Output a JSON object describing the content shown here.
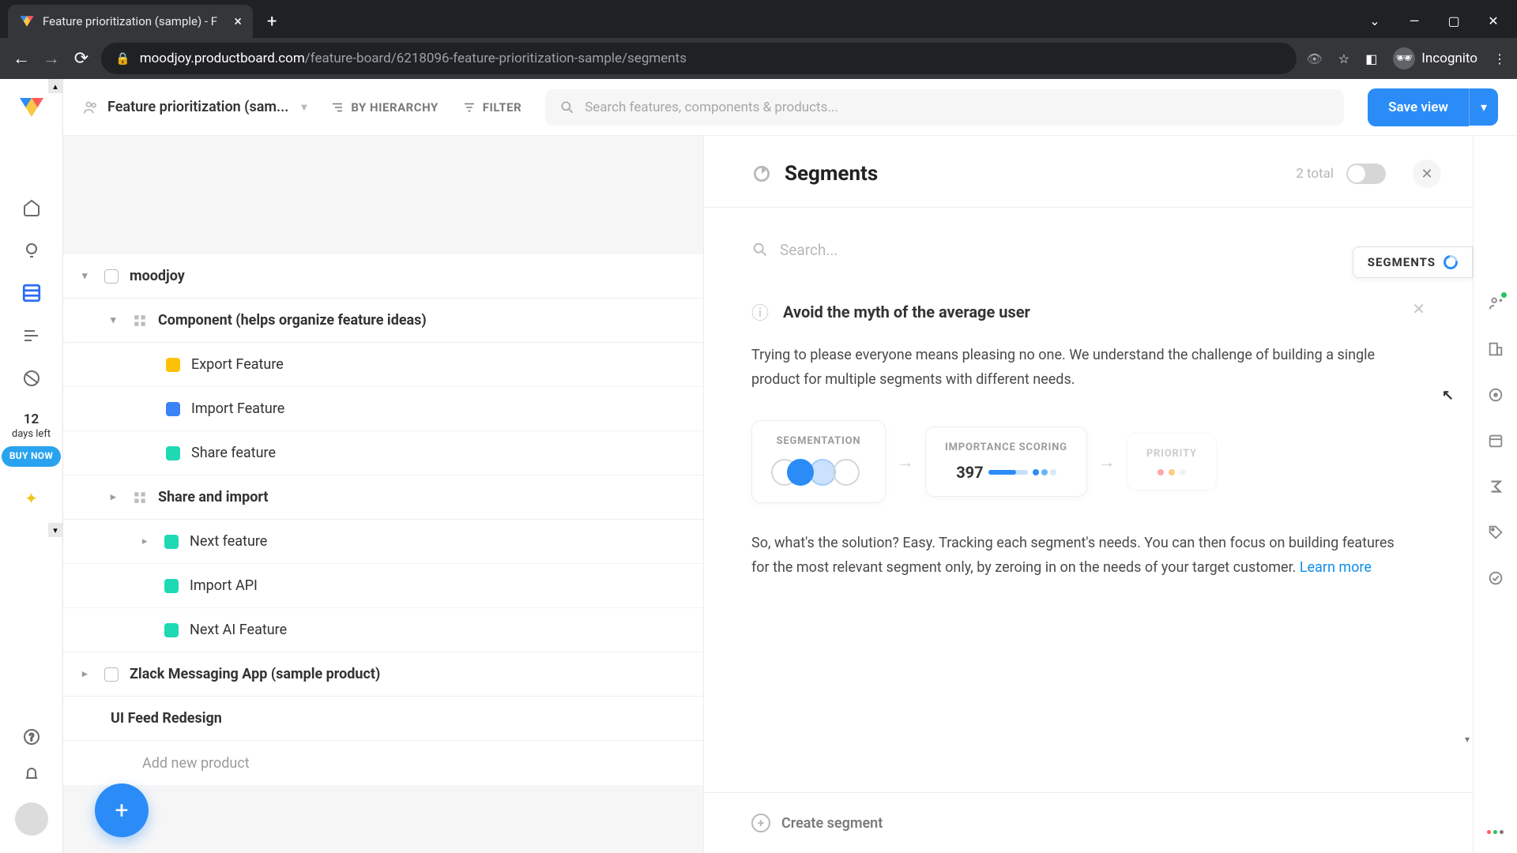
{
  "browser": {
    "tab_title": "Feature prioritization (sample) - F",
    "url_host": "moodjoy.productboard.com",
    "url_path": "/feature-board/6218096-feature-prioritization-sample/segments",
    "incognito_label": "Incognito"
  },
  "rail": {
    "trial_num": "12",
    "trial_label": "days left",
    "buy_now": "BUY NOW"
  },
  "header": {
    "board_title": "Feature prioritization (sam...",
    "by_hierarchy": "BY HIERARCHY",
    "filter": "FILTER",
    "search_placeholder": "Search features, components & products...",
    "save_view": "Save view"
  },
  "tree": {
    "product1": "moodjoy",
    "component1": "Component (helps organize feature ideas)",
    "feat_export": "Export Feature",
    "feat_import": "Import Feature",
    "feat_share": "Share feature",
    "component2": "Share and import",
    "feat_next": "Next feature",
    "feat_import_api": "Import API",
    "feat_next_ai": "Next AI Feature",
    "product2": "Zlack Messaging App (sample product)",
    "product3": "UI Feed Redesign",
    "add_product": "Add new product"
  },
  "segments": {
    "title": "Segments",
    "total": "2 total",
    "search_placeholder": "Search...",
    "tab_label": "SEGMENTS",
    "info_title": "Avoid the myth of the average user",
    "info_text1": "Trying to please everyone means pleasing no one. We understand the challenge of building a single product for multiple segments with different needs.",
    "info_text2": "So, what's the solution? Easy. Tracking each segment's needs. You can then focus on building features for the most relevant segment only, by zeroing in on the needs of your target customer. ",
    "learn_more": "Learn more",
    "step_segmentation": "SEGMENTATION",
    "step_importance": "IMPORTANCE SCORING",
    "step_importance_value": "397",
    "step_priority": "PRIORITY",
    "create_segment": "Create segment"
  }
}
